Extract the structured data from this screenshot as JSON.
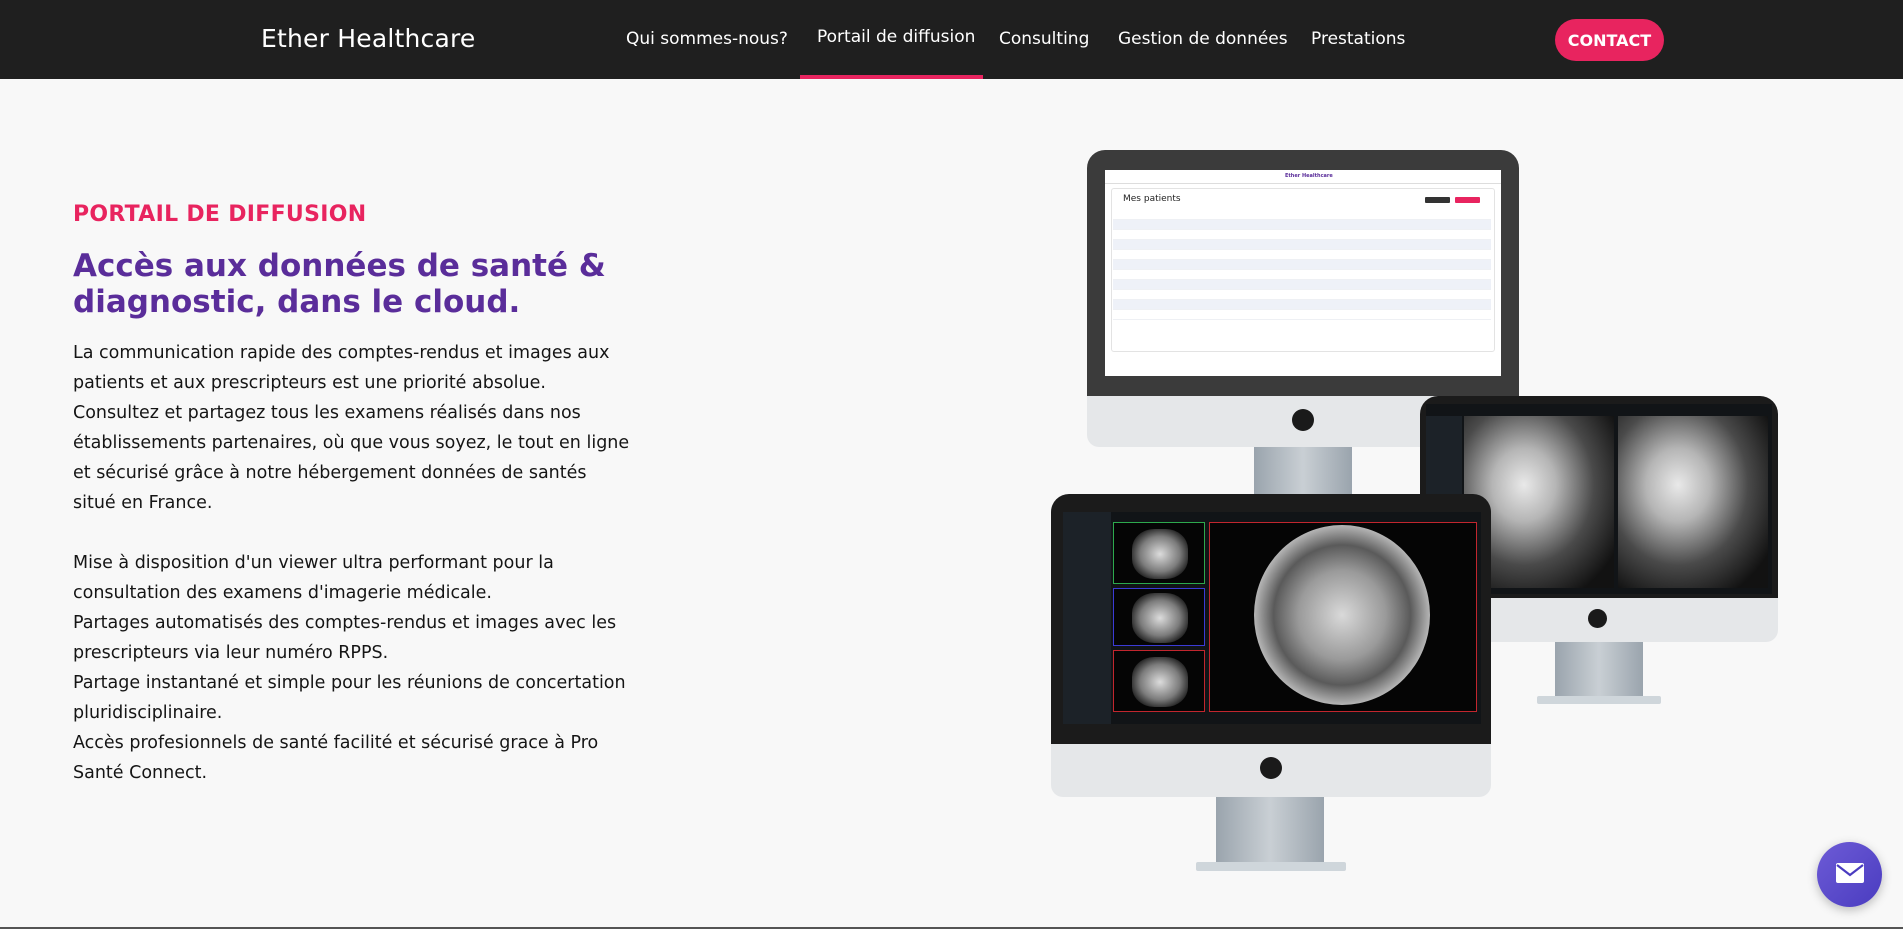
{
  "header": {
    "brand": "Ether Healthcare",
    "nav": [
      {
        "label": "Qui sommes-nous?"
      },
      {
        "label": "Portail de diffusion",
        "active": true
      },
      {
        "label": "Consulting"
      },
      {
        "label": "Gestion de données"
      },
      {
        "label": "Prestations"
      }
    ],
    "contact_label": "CONTACT"
  },
  "main": {
    "section_label": "PORTAIL DE DIFFUSION",
    "headline": "Accès aux données de santé & diagnostic, dans le cloud.",
    "paragraph1": "La communication rapide des comptes-rendus et images aux patients et aux prescripteurs est une priorité absolue. Consultez et partagez tous les examens réalisés dans nos établissements partenaires, où que vous soyez, le tout en ligne et sécurisé grâce à notre hébergement données de santés situé en France.",
    "paragraph2": "Mise à disposition d'un viewer ultra performant pour la consultation des examens d'imagerie médicale.\nPartages automatisés des comptes-rendus et images avec les prescripteurs via leur numéro RPPS.\nPartage instantané et simple pour les réunions de concertation pluridisciplinaire.\nAccès profesionnels de santé facilité et sécurisé grace à Pro Santé Connect."
  },
  "illustration": {
    "portal_title": "Mes patients",
    "portal_logo": "Ether Healthcare"
  },
  "icons": {
    "fab": "envelope-icon"
  },
  "colors": {
    "accent": "#e8245f",
    "headline": "#5a2d9a",
    "navbar": "#1f1f1f",
    "fab": "#5a4ad0"
  }
}
